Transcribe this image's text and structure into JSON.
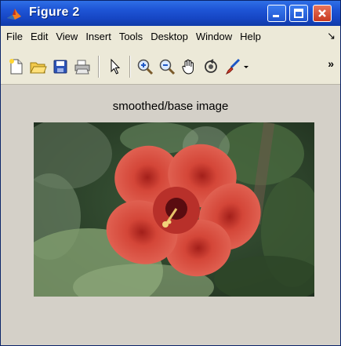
{
  "window": {
    "title": "Figure 2"
  },
  "menubar": {
    "items": [
      "File",
      "Edit",
      "View",
      "Insert",
      "Tools",
      "Desktop",
      "Window",
      "Help"
    ],
    "dock_glyph": "↘"
  },
  "toolbar": {
    "icons": [
      "new-figure-icon",
      "open-file-icon",
      "save-icon",
      "print-icon",
      "edit-plot-arrow-icon",
      "zoom-in-icon",
      "zoom-out-icon",
      "pan-hand-icon",
      "rotate-3d-icon",
      "data-cursor-brush-icon"
    ],
    "more_glyph": "»"
  },
  "figure": {
    "axes_title": "smoothed/base image",
    "image_subject": "red hibiscus flower",
    "background_color": "#d4d0c8",
    "flower_color": "#d9483b"
  }
}
